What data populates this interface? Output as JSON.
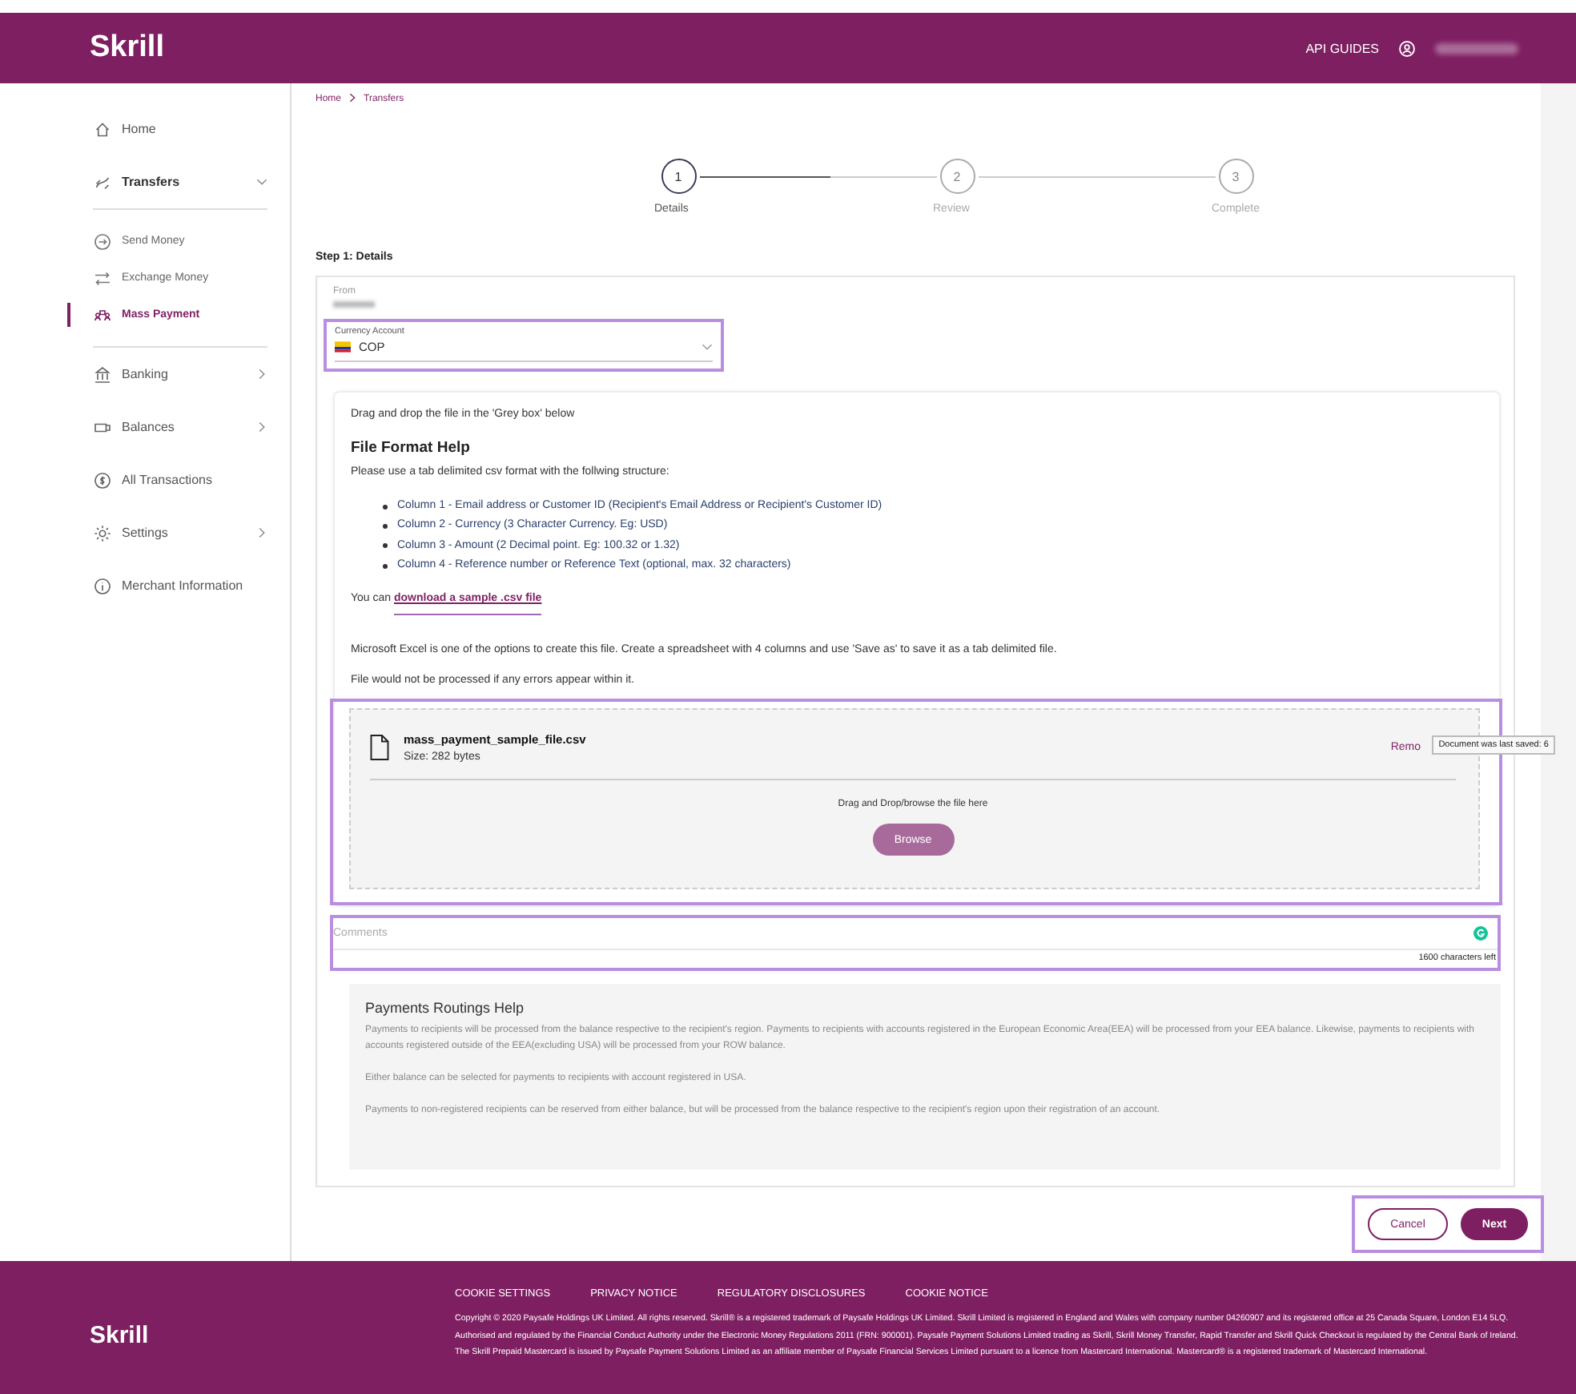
{
  "header": {
    "logo": "Skrill",
    "links": [
      "API GUIDES"
    ]
  },
  "sidebar": {
    "items": [
      {
        "label": "Home",
        "selected": false,
        "kind": "link"
      },
      {
        "label": "Transfers",
        "selected": false,
        "kind": "group",
        "expanded": true,
        "children": [
          {
            "label": "Send Money",
            "selected": false
          },
          {
            "label": "Exchange Money",
            "selected": false
          },
          {
            "label": "Mass Payment",
            "selected": true
          }
        ]
      },
      {
        "label": "Banking",
        "selected": false,
        "kind": "group",
        "expanded": false
      },
      {
        "label": "Balances",
        "selected": false,
        "kind": "group",
        "expanded": false
      },
      {
        "label": "All Transactions",
        "selected": false,
        "kind": "link"
      },
      {
        "label": "Settings",
        "selected": false,
        "kind": "group",
        "expanded": false
      },
      {
        "label": "Merchant Information",
        "selected": false,
        "kind": "link"
      }
    ]
  },
  "breadcrumb": [
    "Home",
    "Transfers"
  ],
  "stepper": [
    {
      "number": "1",
      "label": "Details",
      "active": true
    },
    {
      "number": "2",
      "label": "Review",
      "active": false
    },
    {
      "number": "3",
      "label": "Complete",
      "active": false
    }
  ],
  "step_title": "Step 1: Details",
  "from": {
    "label": "From"
  },
  "currency_account": {
    "label": "Currency Account",
    "value": "COP"
  },
  "help": {
    "intro": "Drag and drop the file in the 'Grey box' below",
    "title": "File Format Help",
    "lead": "Please use a tab delimited csv format with the follwing structure:",
    "columns": [
      "Column 1 - Email address or Customer ID (Recipient's Email Address or Recipient's Customer ID)",
      "Column 2 - Currency (3 Character Currency. Eg: USD)",
      "Column 3 - Amount (2 Decimal point. Eg: 100.32 or 1.32)",
      "Column 4 - Reference number or Reference Text (optional, max. 32 characters)"
    ],
    "download_prefix": "You can",
    "download_link": "download a sample .csv file",
    "excel_note": "Microsoft Excel is one of the options to create this file. Create a spreadsheet with 4 columns and use 'Save as' to save it as a tab delimited file.",
    "error_note": "File would not be processed if any errors appear within it."
  },
  "upload": {
    "file_name": "mass_payment_sample_file.csv",
    "file_size": "Size: 282 bytes",
    "remove": "Remo",
    "tooltip": "Document was last saved: 6",
    "drop_hint": "Drag and Drop/browse the file here",
    "browse": "Browse"
  },
  "comments": {
    "placeholder": "Comments",
    "counter": "1600 characters left"
  },
  "routing_help": {
    "title": "Payments Routings Help",
    "paragraphs": [
      "Payments to recipients will be processed from the balance respective to the recipient's region. Payments to recipients with accounts registered in the European Economic Area(EEA) will be processed from your EEA balance. Likewise, payments to recipients with accounts registered outside of the EEA(excluding USA) will be processed from your ROW balance.",
      "Either balance can be selected for payments to recipients with account registered in USA.",
      "Payments to non-registered recipients can be reserved from either balance, but will be processed from the balance respective to the recipient's region upon their registration of an account."
    ]
  },
  "actions": {
    "cancel": "Cancel",
    "next": "Next"
  },
  "footer": {
    "logo": "Skrill",
    "links": [
      "COOKIE SETTINGS",
      "PRIVACY NOTICE",
      "REGULATORY DISCLOSURES",
      "COOKIE NOTICE"
    ],
    "copyright": "Copyright © 2020 Paysafe Holdings UK Limited. All rights reserved. Skrill® is a registered trademark of Paysafe Holdings UK Limited. Skrill Limited is registered in England and Wales with company number 04260907 and its registered office at 25 Canada Square, London E14 5LQ. Authorised and regulated by the Financial Conduct Authority under the Electronic Money Regulations 2011 (FRN: 900001). Paysafe Payment Solutions Limited trading as Skrill, Skrill Money Transfer, Rapid Transfer and Skrill Quick Checkout is regulated by the Central Bank of Ireland. The Skrill Prepaid Mastercard is issued by Paysafe Payment Solutions Limited as an affiliate member of Paysafe Financial Services Limited pursuant to a licence from Mastercard International. Mastercard® is a registered trademark of Mastercard International."
  }
}
